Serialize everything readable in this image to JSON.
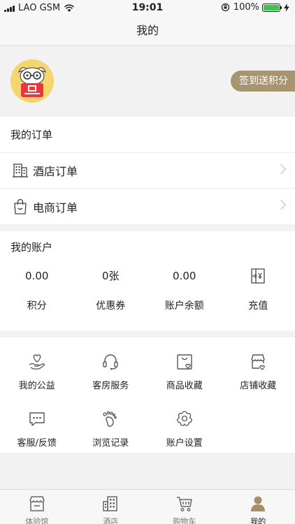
{
  "status": {
    "carrier": "LAO GSM",
    "time": "19:01",
    "battery": "100%"
  },
  "nav": {
    "title": "我的"
  },
  "profile": {
    "checkin_label": "签到送积分"
  },
  "orders": {
    "title": "我的订单",
    "items": [
      {
        "label": "酒店订单",
        "icon": "hotel-icon"
      },
      {
        "label": "电商订单",
        "icon": "shopping-bag-icon"
      }
    ]
  },
  "account": {
    "title": "我的账户",
    "items": [
      {
        "value": "0.00",
        "label": "积分"
      },
      {
        "value": "0张",
        "label": "优惠券"
      },
      {
        "value": "0.00",
        "label": "账户余额"
      },
      {
        "value": "",
        "label": "充值",
        "icon": "recharge-icon"
      }
    ]
  },
  "services": {
    "items": [
      {
        "label": "我的公益",
        "icon": "charity-heart-icon"
      },
      {
        "label": "客房服务",
        "icon": "headset-icon"
      },
      {
        "label": "商品收藏",
        "icon": "product-favorite-icon"
      },
      {
        "label": "店铺收藏",
        "icon": "store-favorite-icon"
      },
      {
        "label": "客服/反馈",
        "icon": "feedback-chat-icon"
      },
      {
        "label": "浏览记录",
        "icon": "footprint-icon"
      },
      {
        "label": "账户设置",
        "icon": "settings-flower-icon"
      }
    ]
  },
  "tabbar": {
    "items": [
      {
        "label": "体验馆",
        "icon": "storefront-icon",
        "active": false
      },
      {
        "label": "酒店",
        "icon": "building-icon",
        "active": false
      },
      {
        "label": "购物车",
        "icon": "cart-icon",
        "active": false
      },
      {
        "label": "我的",
        "icon": "person-icon",
        "active": true
      }
    ]
  },
  "colors": {
    "accent": "#a8946e",
    "battery": "#3ec44a",
    "avatar_bg": "#f5d976"
  }
}
